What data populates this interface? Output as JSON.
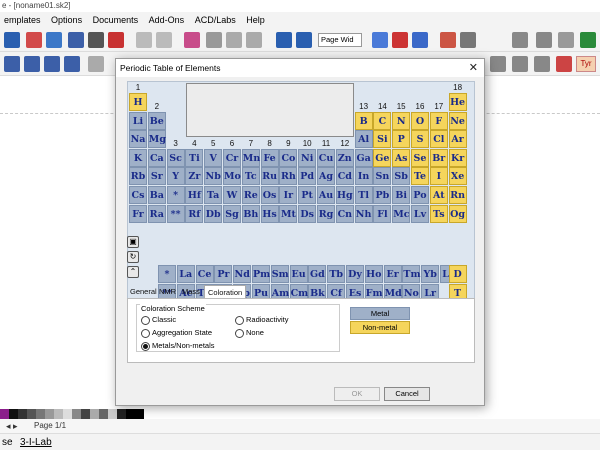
{
  "window": {
    "title": "e - [noname01.sk2]"
  },
  "menu": [
    "emplates",
    "Options",
    "Documents",
    "Add-Ons",
    "ACD/Labs",
    "Help"
  ],
  "toolbar": {
    "zoom_value": "Page Wid",
    "tyr_label": "Tyr"
  },
  "dialog": {
    "title": "Periodic Table of Elements",
    "close": "✕",
    "groups": [
      "1",
      "2",
      "3",
      "4",
      "5",
      "6",
      "7",
      "8",
      "9",
      "10",
      "11",
      "12",
      "13",
      "14",
      "15",
      "16",
      "17",
      "18"
    ],
    "elements": [
      {
        "sym": "H",
        "r": 0,
        "c": 0,
        "t": "nonmetal"
      },
      {
        "sym": "He",
        "r": 0,
        "c": 17,
        "t": "nonmetal"
      },
      {
        "sym": "Li",
        "r": 1,
        "c": 0,
        "t": "metal"
      },
      {
        "sym": "Be",
        "r": 1,
        "c": 1,
        "t": "metal"
      },
      {
        "sym": "B",
        "r": 1,
        "c": 12,
        "t": "nonmetal"
      },
      {
        "sym": "C",
        "r": 1,
        "c": 13,
        "t": "nonmetal"
      },
      {
        "sym": "N",
        "r": 1,
        "c": 14,
        "t": "nonmetal"
      },
      {
        "sym": "O",
        "r": 1,
        "c": 15,
        "t": "nonmetal"
      },
      {
        "sym": "F",
        "r": 1,
        "c": 16,
        "t": "nonmetal"
      },
      {
        "sym": "Ne",
        "r": 1,
        "c": 17,
        "t": "nonmetal"
      },
      {
        "sym": "Na",
        "r": 2,
        "c": 0,
        "t": "metal"
      },
      {
        "sym": "Mg",
        "r": 2,
        "c": 1,
        "t": "metal"
      },
      {
        "sym": "Al",
        "r": 2,
        "c": 12,
        "t": "metal"
      },
      {
        "sym": "Si",
        "r": 2,
        "c": 13,
        "t": "nonmetal"
      },
      {
        "sym": "P",
        "r": 2,
        "c": 14,
        "t": "nonmetal"
      },
      {
        "sym": "S",
        "r": 2,
        "c": 15,
        "t": "nonmetal"
      },
      {
        "sym": "Cl",
        "r": 2,
        "c": 16,
        "t": "nonmetal"
      },
      {
        "sym": "Ar",
        "r": 2,
        "c": 17,
        "t": "nonmetal"
      },
      {
        "sym": "K",
        "r": 3,
        "c": 0,
        "t": "metal"
      },
      {
        "sym": "Ca",
        "r": 3,
        "c": 1,
        "t": "metal"
      },
      {
        "sym": "Sc",
        "r": 3,
        "c": 2,
        "t": "metal"
      },
      {
        "sym": "Ti",
        "r": 3,
        "c": 3,
        "t": "metal"
      },
      {
        "sym": "V",
        "r": 3,
        "c": 4,
        "t": "metal"
      },
      {
        "sym": "Cr",
        "r": 3,
        "c": 5,
        "t": "metal"
      },
      {
        "sym": "Mn",
        "r": 3,
        "c": 6,
        "t": "metal"
      },
      {
        "sym": "Fe",
        "r": 3,
        "c": 7,
        "t": "metal"
      },
      {
        "sym": "Co",
        "r": 3,
        "c": 8,
        "t": "metal"
      },
      {
        "sym": "Ni",
        "r": 3,
        "c": 9,
        "t": "metal"
      },
      {
        "sym": "Cu",
        "r": 3,
        "c": 10,
        "t": "metal"
      },
      {
        "sym": "Zn",
        "r": 3,
        "c": 11,
        "t": "metal"
      },
      {
        "sym": "Ga",
        "r": 3,
        "c": 12,
        "t": "metal"
      },
      {
        "sym": "Ge",
        "r": 3,
        "c": 13,
        "t": "nonmetal"
      },
      {
        "sym": "As",
        "r": 3,
        "c": 14,
        "t": "nonmetal"
      },
      {
        "sym": "Se",
        "r": 3,
        "c": 15,
        "t": "nonmetal"
      },
      {
        "sym": "Br",
        "r": 3,
        "c": 16,
        "t": "nonmetal"
      },
      {
        "sym": "Kr",
        "r": 3,
        "c": 17,
        "t": "nonmetal"
      },
      {
        "sym": "Rb",
        "r": 4,
        "c": 0,
        "t": "metal"
      },
      {
        "sym": "Sr",
        "r": 4,
        "c": 1,
        "t": "metal"
      },
      {
        "sym": "Y",
        "r": 4,
        "c": 2,
        "t": "metal"
      },
      {
        "sym": "Zr",
        "r": 4,
        "c": 3,
        "t": "metal"
      },
      {
        "sym": "Nb",
        "r": 4,
        "c": 4,
        "t": "metal"
      },
      {
        "sym": "Mo",
        "r": 4,
        "c": 5,
        "t": "metal"
      },
      {
        "sym": "Tc",
        "r": 4,
        "c": 6,
        "t": "metal"
      },
      {
        "sym": "Ru",
        "r": 4,
        "c": 7,
        "t": "metal"
      },
      {
        "sym": "Rh",
        "r": 4,
        "c": 8,
        "t": "metal"
      },
      {
        "sym": "Pd",
        "r": 4,
        "c": 9,
        "t": "metal"
      },
      {
        "sym": "Ag",
        "r": 4,
        "c": 10,
        "t": "metal"
      },
      {
        "sym": "Cd",
        "r": 4,
        "c": 11,
        "t": "metal"
      },
      {
        "sym": "In",
        "r": 4,
        "c": 12,
        "t": "metal"
      },
      {
        "sym": "Sn",
        "r": 4,
        "c": 13,
        "t": "metal"
      },
      {
        "sym": "Sb",
        "r": 4,
        "c": 14,
        "t": "metal"
      },
      {
        "sym": "Te",
        "r": 4,
        "c": 15,
        "t": "nonmetal"
      },
      {
        "sym": "I",
        "r": 4,
        "c": 16,
        "t": "nonmetal"
      },
      {
        "sym": "Xe",
        "r": 4,
        "c": 17,
        "t": "nonmetal"
      },
      {
        "sym": "Cs",
        "r": 5,
        "c": 0,
        "t": "metal"
      },
      {
        "sym": "Ba",
        "r": 5,
        "c": 1,
        "t": "metal"
      },
      {
        "sym": "*",
        "r": 5,
        "c": 2,
        "t": "metal"
      },
      {
        "sym": "Hf",
        "r": 5,
        "c": 3,
        "t": "metal"
      },
      {
        "sym": "Ta",
        "r": 5,
        "c": 4,
        "t": "metal"
      },
      {
        "sym": "W",
        "r": 5,
        "c": 5,
        "t": "metal"
      },
      {
        "sym": "Re",
        "r": 5,
        "c": 6,
        "t": "metal"
      },
      {
        "sym": "Os",
        "r": 5,
        "c": 7,
        "t": "metal"
      },
      {
        "sym": "Ir",
        "r": 5,
        "c": 8,
        "t": "metal"
      },
      {
        "sym": "Pt",
        "r": 5,
        "c": 9,
        "t": "metal"
      },
      {
        "sym": "Au",
        "r": 5,
        "c": 10,
        "t": "metal"
      },
      {
        "sym": "Hg",
        "r": 5,
        "c": 11,
        "t": "metal"
      },
      {
        "sym": "Tl",
        "r": 5,
        "c": 12,
        "t": "metal"
      },
      {
        "sym": "Pb",
        "r": 5,
        "c": 13,
        "t": "metal"
      },
      {
        "sym": "Bi",
        "r": 5,
        "c": 14,
        "t": "metal"
      },
      {
        "sym": "Po",
        "r": 5,
        "c": 15,
        "t": "metal"
      },
      {
        "sym": "At",
        "r": 5,
        "c": 16,
        "t": "nonmetal"
      },
      {
        "sym": "Rn",
        "r": 5,
        "c": 17,
        "t": "nonmetal"
      },
      {
        "sym": "Fr",
        "r": 6,
        "c": 0,
        "t": "metal"
      },
      {
        "sym": "Ra",
        "r": 6,
        "c": 1,
        "t": "metal"
      },
      {
        "sym": "**",
        "r": 6,
        "c": 2,
        "t": "metal"
      },
      {
        "sym": "Rf",
        "r": 6,
        "c": 3,
        "t": "metal"
      },
      {
        "sym": "Db",
        "r": 6,
        "c": 4,
        "t": "metal"
      },
      {
        "sym": "Sg",
        "r": 6,
        "c": 5,
        "t": "metal"
      },
      {
        "sym": "Bh",
        "r": 6,
        "c": 6,
        "t": "metal"
      },
      {
        "sym": "Hs",
        "r": 6,
        "c": 7,
        "t": "metal"
      },
      {
        "sym": "Mt",
        "r": 6,
        "c": 8,
        "t": "metal"
      },
      {
        "sym": "Ds",
        "r": 6,
        "c": 9,
        "t": "metal"
      },
      {
        "sym": "Rg",
        "r": 6,
        "c": 10,
        "t": "metal"
      },
      {
        "sym": "Cn",
        "r": 6,
        "c": 11,
        "t": "metal"
      },
      {
        "sym": "Nh",
        "r": 6,
        "c": 12,
        "t": "metal"
      },
      {
        "sym": "Fl",
        "r": 6,
        "c": 13,
        "t": "metal"
      },
      {
        "sym": "Mc",
        "r": 6,
        "c": 14,
        "t": "metal"
      },
      {
        "sym": "Lv",
        "r": 6,
        "c": 15,
        "t": "metal"
      },
      {
        "sym": "Ts",
        "r": 6,
        "c": 16,
        "t": "nonmetal"
      },
      {
        "sym": "Og",
        "r": 6,
        "c": 17,
        "t": "nonmetal"
      }
    ],
    "lanthanides": [
      "*",
      "La",
      "Ce",
      "Pr",
      "Nd",
      "Pm",
      "Sm",
      "Eu",
      "Gd",
      "Tb",
      "Dy",
      "Ho",
      "Er",
      "Tm",
      "Yb",
      "Lu"
    ],
    "actinides": [
      "**",
      "Ac",
      "Th",
      "U",
      "Np",
      "Pu",
      "Am",
      "Cm",
      "Bk",
      "Cf",
      "Es",
      "Fm",
      "Md",
      "No",
      "Lr"
    ],
    "extra": [
      "D",
      "T"
    ],
    "tabs": [
      "General",
      "NMR",
      "Mass",
      "Coloration"
    ],
    "active_tab": "Coloration",
    "coloration": {
      "title": "Coloration Scheme",
      "options": [
        "Classic",
        "Radioactivity",
        "Aggregation State",
        "None",
        "Metals/Non-metals"
      ],
      "selected": "Metals/Non-metals"
    },
    "legend": {
      "metal": "Metal",
      "nonmetal": "Non-metal"
    },
    "buttons": {
      "ok": "OK",
      "cancel": "Cancel"
    }
  },
  "colors": {
    "metal": "#9fb0c8",
    "nonmetal": "#f5d55c",
    "element_text": "#1a2b8a"
  },
  "status": {
    "page": "Page 1/1"
  },
  "bottom": {
    "item1": "se",
    "item2": "3-I-Lab"
  }
}
